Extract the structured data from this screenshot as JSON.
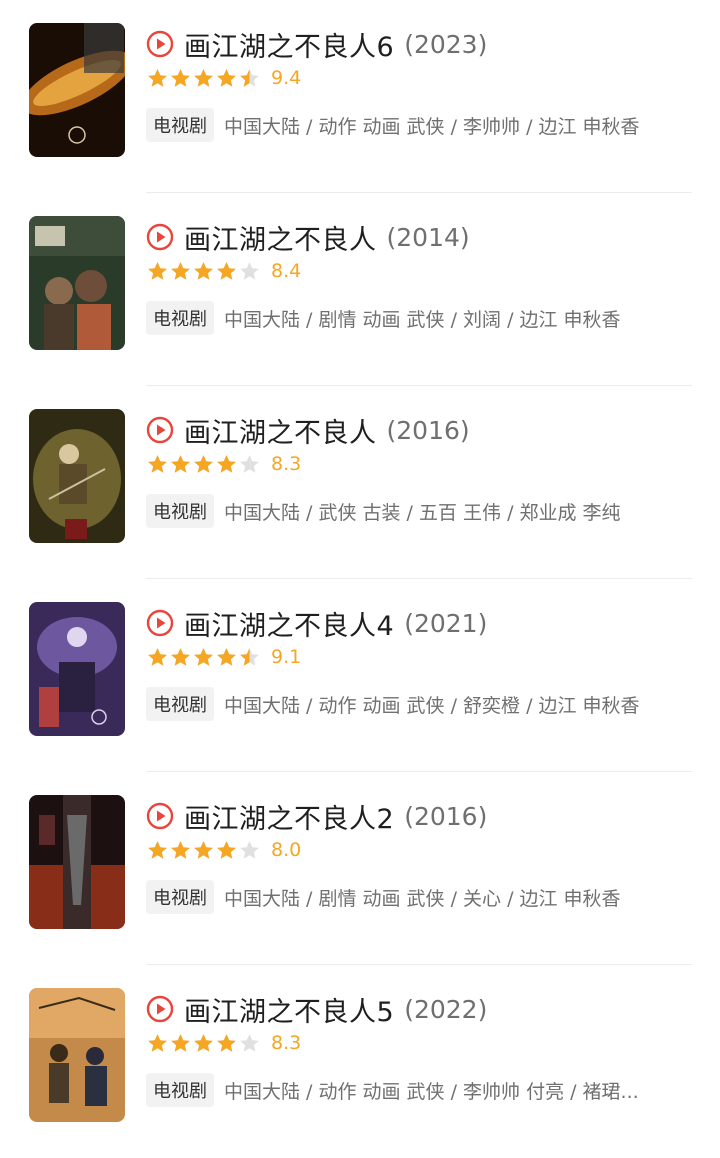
{
  "accent_color": "#e8453c",
  "star_color": "#f5a623",
  "items": [
    {
      "title": "画江湖之不良人6",
      "year": "(2023)",
      "score": "9.4",
      "rating": 4.5,
      "tag": "电视剧",
      "meta": "中国大陆 / 动作 动画 武侠 / 李帅帅 / 边江 申秋香",
      "play_icon": "play-circle-icon"
    },
    {
      "title": "画江湖之不良人",
      "year": "(2014)",
      "score": "8.4",
      "rating": 4.0,
      "tag": "电视剧",
      "meta": "中国大陆 / 剧情 动画 武侠 / 刘阔 / 边江 申秋香",
      "play_icon": "play-circle-icon"
    },
    {
      "title": "画江湖之不良人",
      "year": "(2016)",
      "score": "8.3",
      "rating": 4.0,
      "tag": "电视剧",
      "meta": "中国大陆 / 武侠 古装 / 五百 王伟 / 郑业成 李纯",
      "play_icon": "play-circle-icon"
    },
    {
      "title": "画江湖之不良人4",
      "year": "(2021)",
      "score": "9.1",
      "rating": 4.5,
      "tag": "电视剧",
      "meta": "中国大陆 / 动作 动画 武侠 / 舒奕橙 / 边江 申秋香",
      "play_icon": "play-circle-icon"
    },
    {
      "title": "画江湖之不良人2",
      "year": "(2016)",
      "score": "8.0",
      "rating": 4.0,
      "tag": "电视剧",
      "meta": "中国大陆 / 剧情 动画 武侠 / 关心 / 边江 申秋香",
      "play_icon": "play-circle-icon"
    },
    {
      "title": "画江湖之不良人5",
      "year": "(2022)",
      "score": "8.3",
      "rating": 4.0,
      "tag": "电视剧",
      "meta": "中国大陆 / 动作 动画 武侠 / 李帅帅 付亮 / 褚珺...",
      "play_icon": "play-circle-icon"
    }
  ]
}
